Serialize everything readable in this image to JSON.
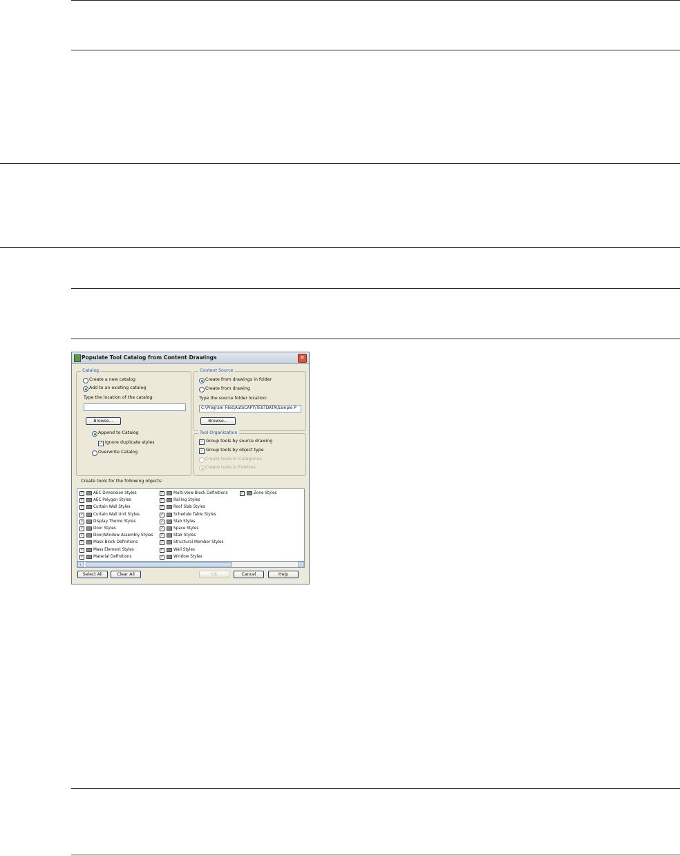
{
  "dialog": {
    "title": "Populate Tool Catalog from Content Drawings",
    "close_glyph": "✕",
    "catalog": {
      "group_label": "Catalog",
      "create_new": "Create a new catalog",
      "add_existing": "Add to an existing catalog",
      "location_label": "Type the location of the catalog:",
      "location_value": "",
      "browse": "Browse...",
      "append": "Append to Catalog",
      "ignore_dup": "Ignore duplicate styles",
      "overwrite": "Overwrite Catalog"
    },
    "content_source": {
      "group_label": "Content Source",
      "from_folder": "Create from drawings in folder",
      "from_drawing": "Create from drawing",
      "folder_label": "Type the source folder location:",
      "folder_value": "C:\\Program Files\\AutoCAPT\\TESTDATA\\Sample P",
      "browse": "Browse..."
    },
    "tool_org": {
      "group_label": "Tool Organization",
      "by_source": "Group tools by source drawing",
      "by_type": "Group tools by object type",
      "in_categories": "Create tools in Categories",
      "in_palettes": "Create tools in Palettes"
    },
    "objects_label": "Create tools for the following objects:",
    "objects": {
      "col1": [
        "AEC Dimension Styles",
        "AEC Polygon Styles",
        "Curtain Wall Styles",
        "Curtain Wall Unit Styles",
        "Display Theme Styles",
        "Door Styles",
        "Door/Window Assembly Styles",
        "Mask Block Definitions",
        "Mass Element Styles",
        "Material Definitions"
      ],
      "col2": [
        "Multi-View Block Definitions",
        "Railing Styles",
        "Roof Slab Styles",
        "Schedule Table Styles",
        "Slab Styles",
        "Space Styles",
        "Stair Styles",
        "Structural Member Styles",
        "Wall Styles",
        "Window Styles"
      ],
      "col3": [
        "Zone Styles"
      ]
    },
    "check_glyph": "✓",
    "scroll_left": "‹",
    "scroll_right": "›",
    "buttons": {
      "select_all": "Select All",
      "clear_all": "Clear All",
      "ok": "OK",
      "cancel": "Cancel",
      "help": "Help"
    }
  }
}
